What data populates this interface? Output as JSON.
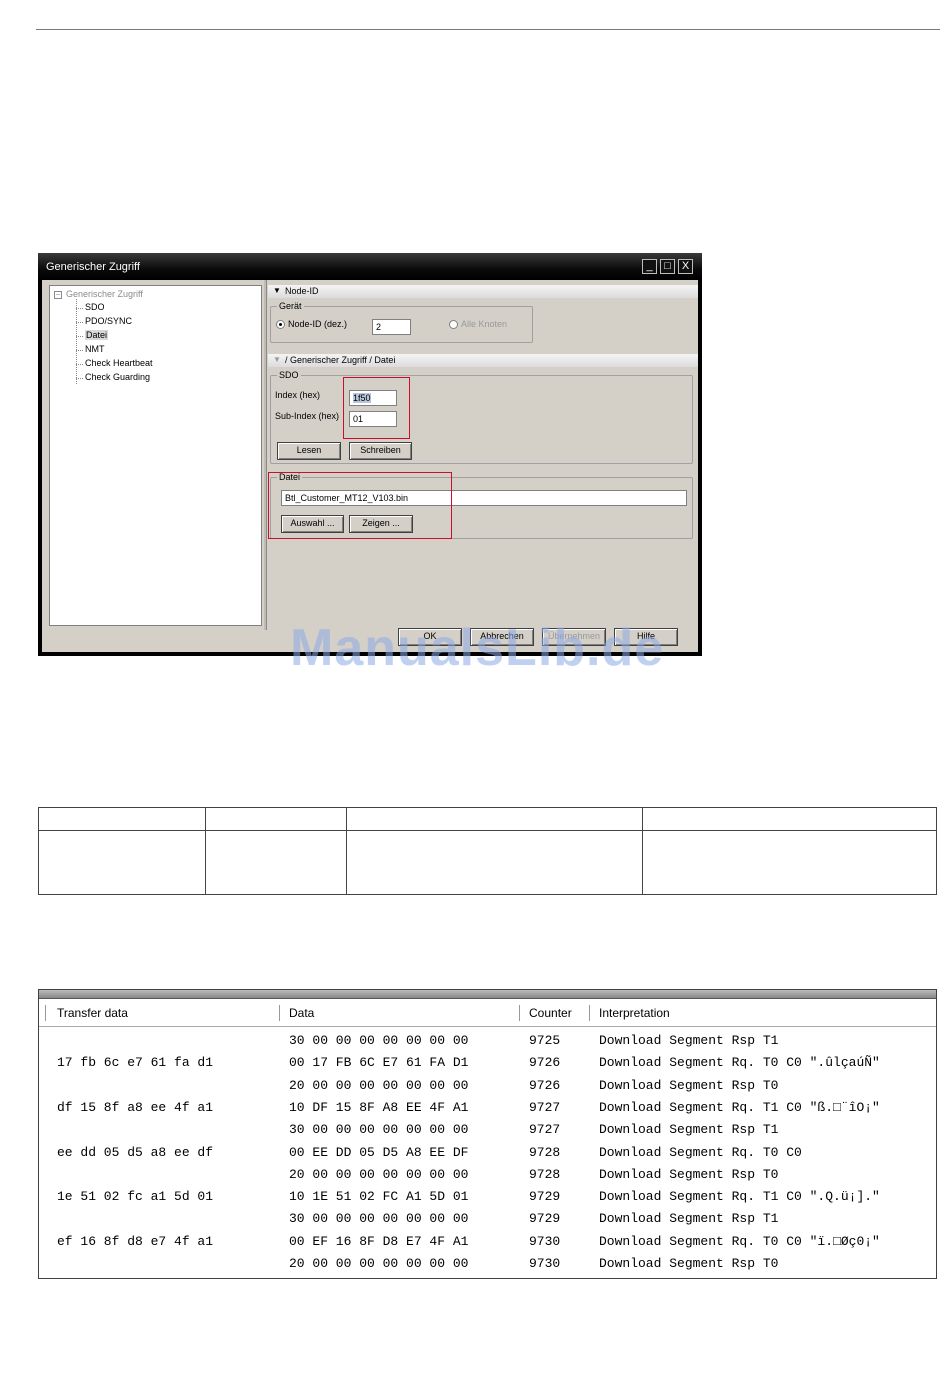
{
  "dialog": {
    "title": "Generischer Zugriff",
    "window_buttons": {
      "minimize": "_",
      "maximize": "□",
      "close": "X"
    },
    "tree": {
      "root": "Generischer Zugriff",
      "items": [
        "SDO",
        "PDO/SYNC",
        "Datei",
        "NMT",
        "Check Heartbeat",
        "Check Guarding"
      ],
      "selected": "Datei"
    },
    "node_section": {
      "header": "Node-ID",
      "group_label": "Gerät",
      "radio_node_label": "Node-ID (dez.)",
      "node_id_value": "2",
      "radio_all_label": "Alle Knoten"
    },
    "access_section": {
      "header": "/ Generischer Zugriff / Datei",
      "sdo_group_label": "SDO",
      "index_label": "Index (hex)",
      "index_value": "1f50",
      "subindex_label": "Sub-Index (hex)",
      "subindex_value": "01",
      "read_button": "Lesen",
      "write_button": "Schreiben"
    },
    "file_section": {
      "group_label": "Datei",
      "file_value": "Btl_Customer_MT12_V103.bin",
      "select_button": "Auswahl ...",
      "show_button": "Zeigen ..."
    },
    "footer_buttons": [
      "OK",
      "Abbrechen",
      "Übernehmen",
      "Hilfe"
    ],
    "footer_buttons_visible": [
      "OK",
      "Abbrechen",
      "Übernehmen",
      "Hilfe"
    ]
  },
  "watermark": "ManualsLib.de",
  "log": {
    "columns": [
      "Transfer data",
      "Data",
      "Counter",
      "Interpretation"
    ],
    "rows": [
      {
        "transfer": "",
        "data": "30 00 00 00 00 00 00 00",
        "counter": "9725",
        "interp": "Download Segment Rsp T1"
      },
      {
        "transfer": "17 fb 6c e7 61 fa d1",
        "data": "00 17 FB 6C E7 61 FA D1",
        "counter": "9726",
        "interp": "Download Segment Rq. T0 C0 \".ûlçaúÑ\""
      },
      {
        "transfer": "",
        "data": "20 00 00 00 00 00 00 00",
        "counter": "9726",
        "interp": "Download Segment Rsp T0"
      },
      {
        "transfer": "df 15 8f a8 ee 4f a1",
        "data": "10 DF 15 8F A8 EE 4F A1",
        "counter": "9727",
        "interp": "Download Segment Rq. T1 C0 \"ß.□¨îO¡\""
      },
      {
        "transfer": "",
        "data": "30 00 00 00 00 00 00 00",
        "counter": "9727",
        "interp": "Download Segment Rsp T1"
      },
      {
        "transfer": "ee dd 05 d5 a8 ee df",
        "data": "00 EE DD 05 D5 A8 EE DF",
        "counter": "9728",
        "interp": "Download Segment Rq. T0 C0"
      },
      {
        "transfer": "",
        "data": "20 00 00 00 00 00 00 00",
        "counter": "9728",
        "interp": "Download Segment Rsp T0"
      },
      {
        "transfer": "1e 51 02 fc a1 5d 01",
        "data": "10 1E 51 02 FC A1 5D 01",
        "counter": "9729",
        "interp": "Download Segment Rq. T1 C0 \".Q.ü¡].\""
      },
      {
        "transfer": "",
        "data": "30 00 00 00 00 00 00 00",
        "counter": "9729",
        "interp": "Download Segment Rsp T1"
      },
      {
        "transfer": "ef 16 8f d8 e7 4f a1",
        "data": "00 EF 16 8F D8 E7 4F A1",
        "counter": "9730",
        "interp": "Download Segment Rq. T0 C0 \"ï.□Øç0¡\""
      },
      {
        "transfer": "",
        "data": "20 00 00 00 00 00 00 00",
        "counter": "9730",
        "interp": "Download Segment Rsp T0"
      }
    ]
  }
}
